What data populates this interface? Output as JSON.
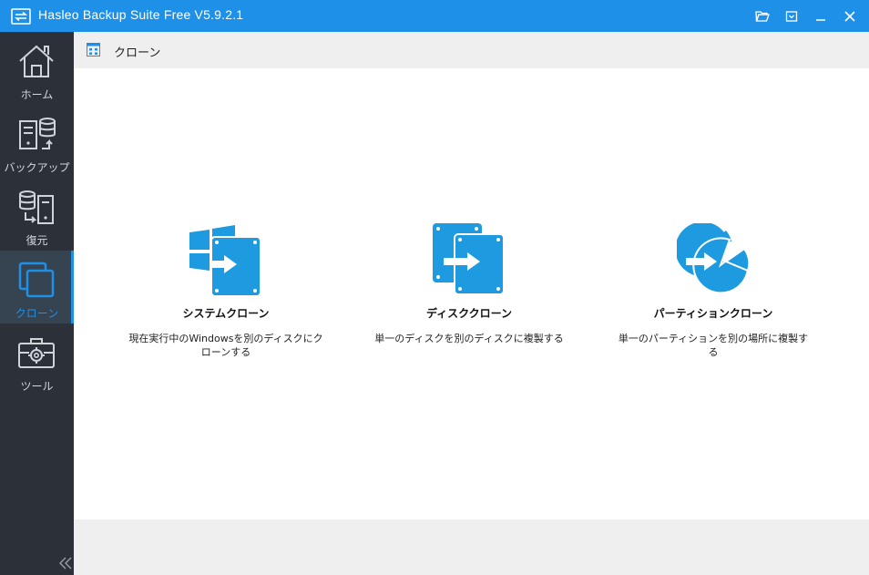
{
  "window": {
    "title": "Hasleo Backup Suite Free V5.9.2.1",
    "accent": "#1e90e8",
    "sidebar_bg": "#2c3038"
  },
  "titlebar_buttons": [
    {
      "name": "open-folder",
      "icon": "folder-open-icon"
    },
    {
      "name": "menu",
      "icon": "menu-dropdown-icon"
    },
    {
      "name": "minimize",
      "icon": "minimize-icon"
    },
    {
      "name": "close",
      "icon": "close-icon"
    }
  ],
  "sidebar": {
    "items": [
      {
        "label": "ホーム",
        "icon": "home-icon",
        "active": false
      },
      {
        "label": "バックアップ",
        "icon": "backup-icon",
        "active": false
      },
      {
        "label": "復元",
        "icon": "restore-icon",
        "active": false
      },
      {
        "label": "クローン",
        "icon": "clone-icon",
        "active": true
      },
      {
        "label": "ツール",
        "icon": "toolbox-icon",
        "active": false
      }
    ],
    "collapse_icon": "double-chevron-left-icon"
  },
  "header": {
    "title": "クローン",
    "icon": "grid-icon"
  },
  "cards": [
    {
      "title": "システムクローン",
      "desc": "現在実行中のWindowsを別のディスクにクローンする",
      "icon": "system-clone-icon"
    },
    {
      "title": "ディスククローン",
      "desc": "単一のディスクを別のディスクに複製する",
      "icon": "disk-clone-icon"
    },
    {
      "title": "パーティションクローン",
      "desc": "単一のパーティションを別の場所に複製する",
      "icon": "partition-clone-icon"
    }
  ]
}
